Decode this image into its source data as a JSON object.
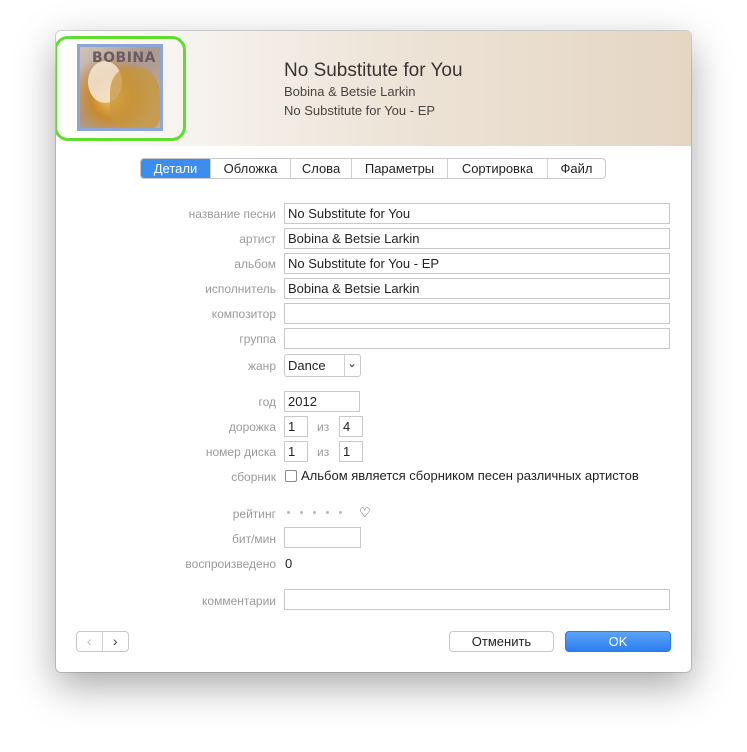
{
  "header": {
    "title": "No Substitute for You",
    "artist": "Bobina & Betsie Larkin",
    "album": "No Substitute for You - EP",
    "artwork_logo": "BOBINA"
  },
  "tabs": [
    {
      "label": "Детали",
      "active": true
    },
    {
      "label": "Обложка",
      "active": false
    },
    {
      "label": "Слова",
      "active": false
    },
    {
      "label": "Параметры",
      "active": false
    },
    {
      "label": "Сортировка",
      "active": false
    },
    {
      "label": "Файл",
      "active": false
    }
  ],
  "form": {
    "song_name": {
      "label": "название песни",
      "value": "No Substitute for You"
    },
    "artist": {
      "label": "артист",
      "value": "Bobina & Betsie Larkin"
    },
    "album": {
      "label": "альбом",
      "value": "No Substitute for You - EP"
    },
    "album_artist": {
      "label": "исполнитель",
      "value": "Bobina & Betsie Larkin"
    },
    "composer": {
      "label": "композитор",
      "value": ""
    },
    "grouping": {
      "label": "группа",
      "value": ""
    },
    "genre": {
      "label": "жанр",
      "value": "Dance"
    },
    "year": {
      "label": "год",
      "value": "2012"
    },
    "track": {
      "label": "дорожка",
      "number": "1",
      "of_label": "из",
      "total": "4"
    },
    "disc": {
      "label": "номер диска",
      "number": "1",
      "of_label": "из",
      "total": "1"
    },
    "compilation": {
      "label": "сборник",
      "checkbox_label": "Альбом является сборником песен различных артистов",
      "checked": false
    },
    "rating": {
      "label": "рейтинг",
      "stars": 0,
      "loved": false
    },
    "bpm": {
      "label": "бит/мин",
      "value": ""
    },
    "plays": {
      "label": "воспроизведено",
      "value": "0"
    },
    "comments": {
      "label": "комментарии",
      "value": ""
    }
  },
  "footer": {
    "prev_icon": "‹",
    "next_icon": "›",
    "cancel_label": "Отменить",
    "ok_label": "OK"
  },
  "colors": {
    "accent": "#3d8cf0",
    "focus_ring": "#5fdc2f"
  }
}
